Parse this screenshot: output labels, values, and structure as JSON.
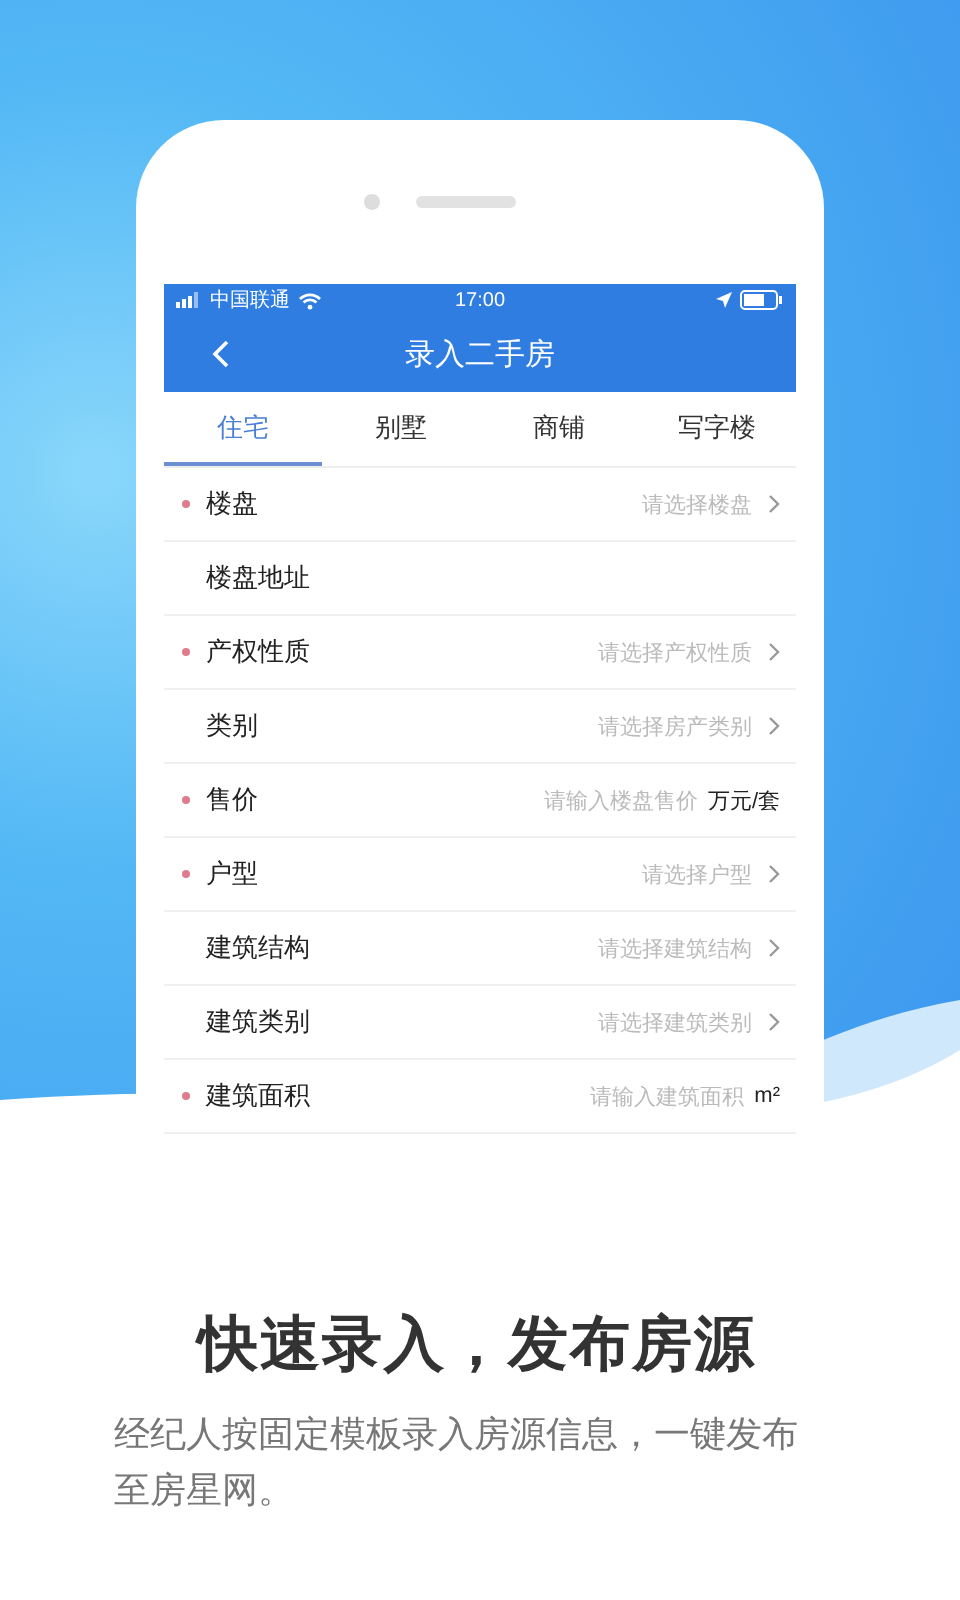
{
  "status_bar": {
    "carrier": "中国联通",
    "time": "17:00"
  },
  "nav_bar": {
    "title": "录入二手房"
  },
  "tabs": [
    {
      "label": "住宅",
      "selected": true
    },
    {
      "label": "别墅",
      "selected": false
    },
    {
      "label": "商铺",
      "selected": false
    },
    {
      "label": "写字楼",
      "selected": false
    }
  ],
  "form_rows": [
    {
      "kind": "select",
      "label": "楼盘",
      "required": true,
      "placeholder": "请选择楼盘"
    },
    {
      "kind": "plain",
      "label": "楼盘地址",
      "required": false
    },
    {
      "kind": "select",
      "label": "产权性质",
      "required": true,
      "placeholder": "请选择产权性质"
    },
    {
      "kind": "select",
      "label": "类别",
      "required": false,
      "placeholder": "请选择房产类别"
    },
    {
      "kind": "input",
      "label": "售价",
      "required": true,
      "placeholder": "请输入楼盘售价",
      "unit": "万元/套"
    },
    {
      "kind": "select",
      "label": "户型",
      "required": true,
      "placeholder": "请选择户型"
    },
    {
      "kind": "select",
      "label": "建筑结构",
      "required": false,
      "placeholder": "请选择建筑结构"
    },
    {
      "kind": "select",
      "label": "建筑类别",
      "required": false,
      "placeholder": "请选择建筑类别"
    },
    {
      "kind": "input",
      "label": "建筑面积",
      "required": true,
      "placeholder": "请输入建筑面积",
      "unit": "m²"
    }
  ],
  "headline": "快速录入，发布房源",
  "description": "经纪人按固定模板录入房源信息，一键发布至房星网。"
}
